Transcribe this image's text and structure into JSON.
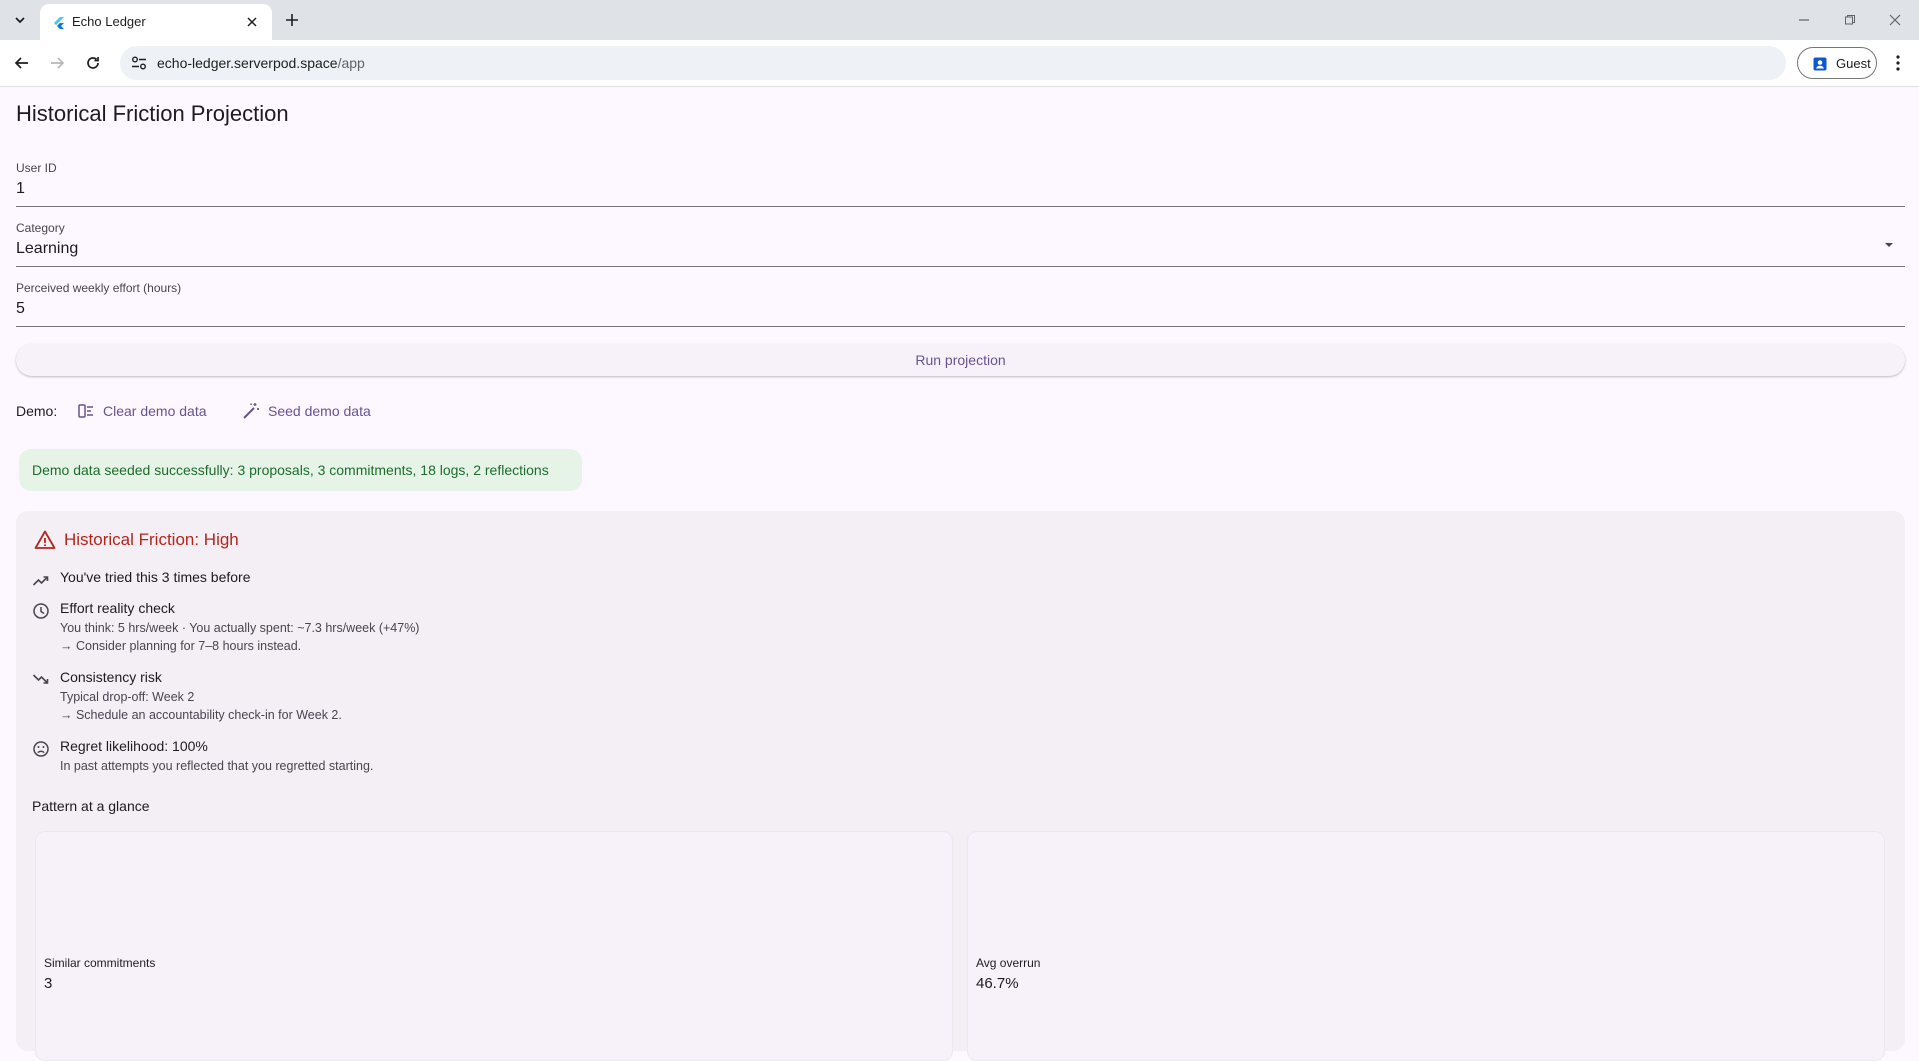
{
  "browser": {
    "tab_title": "Echo Ledger",
    "url_host": "echo-ledger.serverpod.space",
    "url_path": "/app",
    "profile_label": "Guest"
  },
  "page": {
    "title": "Historical Friction Projection"
  },
  "form": {
    "user_id": {
      "label": "User ID",
      "value": "1"
    },
    "category": {
      "label": "Category",
      "value": "Learning"
    },
    "effort": {
      "label": "Perceived weekly effort (hours)",
      "value": "5"
    },
    "run_button": "Run projection"
  },
  "demo": {
    "label": "Demo:",
    "clear_label": "Clear demo data",
    "seed_label": "Seed demo data",
    "banner": "Demo data seeded successfully: 3 proposals, 3 commitments, 18 logs, 2 reflections"
  },
  "result": {
    "heading": "Historical Friction: High",
    "tried": "You've tried this 3 times before",
    "effort_title": "Effort reality check",
    "effort_line1": "You think: 5 hrs/week · You actually spent: ~7.3 hrs/week (+47%)",
    "effort_line2": "→ Consider planning for 7–8 hours instead.",
    "consistency_title": "Consistency risk",
    "consistency_line1": "Typical drop-off: Week 2",
    "consistency_line2": "→ Schedule an accountability check-in for Week 2.",
    "regret_title": "Regret likelihood: 100%",
    "regret_line1": "In past attempts you reflected that you regretted starting.",
    "pattern_title": "Pattern at a glance",
    "stats": [
      {
        "label": "Similar commitments",
        "value": "3"
      },
      {
        "label": "Avg overrun",
        "value": "46.7%"
      }
    ]
  },
  "colors": {
    "accent": "#65558f",
    "danger": "#b3261e",
    "success_bg": "#e6f4e8",
    "success_text": "#1f6b2c",
    "page_bg": "#fdf7ff"
  },
  "icons": {
    "tab_list": "chevron-down-icon",
    "favicon": "flutter-icon",
    "close": "close-icon",
    "new_tab": "plus-icon",
    "back": "arrow-left-icon",
    "forward": "arrow-right-icon",
    "reload": "reload-icon",
    "site_info": "tune-icon",
    "profile": "person-badge-icon",
    "menu": "kebab-icon",
    "clear": "clear-list-icon",
    "seed": "magic-wand-icon",
    "warning": "warning-icon",
    "tried": "trending-up-icon",
    "effort": "clock-icon",
    "consistency": "trending-down-icon",
    "regret": "sad-face-icon"
  }
}
